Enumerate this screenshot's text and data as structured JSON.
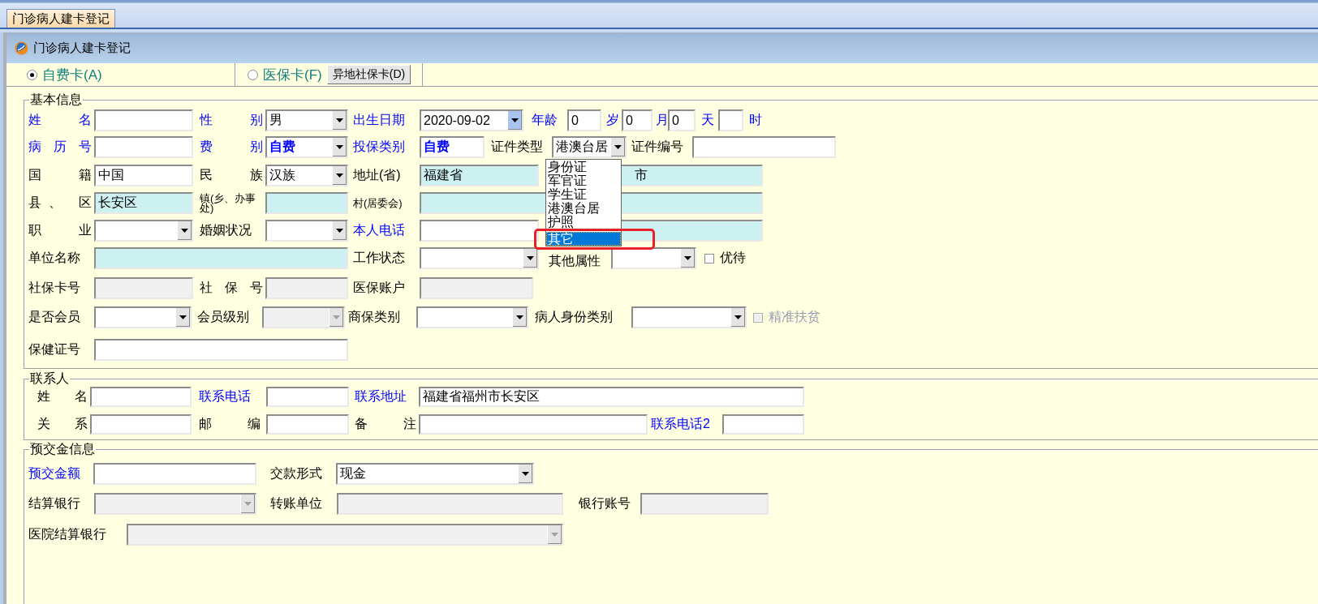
{
  "tab_bar": {
    "tabs": [
      {
        "label": "门诊病人建卡登记",
        "selected": true
      }
    ]
  },
  "window": {
    "title": "门诊病人建卡登记"
  },
  "card_types": [
    {
      "label": "自费卡(A)",
      "selected": true
    },
    {
      "label": "医保卡(F)",
      "selected": false
    }
  ],
  "remote_card_button": "异地社保卡(D)",
  "sections": [
    {
      "title": "基本信息",
      "lines": [
        {
          "items": [
            {
              "kind": "spaced_label",
              "text": "姓 名",
              "required": true
            },
            {
              "kind": "field"
            },
            {
              "kind": "spaced_label",
              "text": "性 别",
              "required": true
            },
            {
              "kind": "combo",
              "value": "男",
              "disabled": false
            },
            {
              "kind": "label",
              "text": "出生日期",
              "required": true
            },
            {
              "kind": "date",
              "value": "2020-09-02"
            },
            {
              "kind": "label",
              "text": "年龄",
              "required": true
            },
            {
              "kind": "field",
              "value": "0"
            },
            {
              "kind": "label",
              "text": "岁",
              "required": true
            },
            {
              "kind": "field",
              "value": "0"
            },
            {
              "kind": "label",
              "text": "月",
              "required": true
            },
            {
              "kind": "field",
              "value": "0"
            },
            {
              "kind": "label",
              "text": "天",
              "required": true
            },
            {
              "kind": "field"
            },
            {
              "kind": "label",
              "text": "时",
              "required": true
            }
          ]
        },
        {
          "items": [
            {
              "kind": "spaced_label",
              "text": "病 历 号",
              "required": true
            },
            {
              "kind": "field"
            },
            {
              "kind": "spaced_label",
              "text": "费 别",
              "required": true
            },
            {
              "kind": "combo",
              "value": "自费",
              "disabled": false,
              "bold": true
            },
            {
              "kind": "label",
              "text": "投保类别",
              "required": true
            },
            {
              "kind": "field",
              "value": "自费",
              "bold": true
            },
            {
              "kind": "label",
              "text": "证件类型",
              "required": false
            },
            {
              "kind": "combo",
              "value": "港澳台居",
              "disabled": false
            },
            {
              "kind": "label",
              "text": "证件编号",
              "required": false
            },
            {
              "kind": "field"
            }
          ]
        },
        {
          "items": [
            {
              "kind": "spaced_label",
              "text": "国 籍",
              "required": false
            },
            {
              "kind": "field",
              "value": "中国"
            },
            {
              "kind": "spaced_label",
              "text": "民 族",
              "required": false
            },
            {
              "kind": "combo",
              "value": "汉族",
              "disabled": false
            },
            {
              "kind": "label",
              "text": "地址(省)",
              "required": false
            },
            {
              "kind": "filled_field",
              "value": "福建省"
            },
            {
              "kind": "filled_field",
              "value": "市"
            }
          ]
        },
        {
          "items": [
            {
              "kind": "spaced_label",
              "text": "县、 区",
              "required": false
            },
            {
              "kind": "filled_field",
              "value": "长安区"
            },
            {
              "kind": "small_label",
              "text": "镇(乡、办事处)",
              "required": false
            },
            {
              "kind": "filled_field"
            },
            {
              "kind": "small_label",
              "text": "村(居委会)",
              "required": false
            },
            {
              "kind": "filled_field"
            }
          ]
        },
        {
          "items": [
            {
              "kind": "spaced_label",
              "text": "职 业",
              "required": false
            },
            {
              "kind": "combo",
              "disabled": false
            },
            {
              "kind": "label",
              "text": "婚姻状况",
              "required": false
            },
            {
              "kind": "combo",
              "disabled": false
            },
            {
              "kind": "label",
              "text": "本人电话",
              "required": true
            },
            {
              "kind": "field"
            },
            {
              "kind": "filled_field"
            }
          ]
        },
        {
          "items": [
            {
              "kind": "label",
              "text": "单位名称",
              "required": false
            },
            {
              "kind": "filled_field"
            },
            {
              "kind": "label",
              "text": "工作状态",
              "required": false
            },
            {
              "kind": "combo",
              "disabled": false
            },
            {
              "kind": "label",
              "text": "其他属性",
              "required": false
            },
            {
              "kind": "combo",
              "disabled": false
            },
            {
              "kind": "checkbox",
              "text": "优待",
              "checked": false,
              "disabled": false
            }
          ]
        },
        {
          "items": [
            {
              "kind": "label",
              "text": "社保卡号",
              "required": false
            },
            {
              "kind": "readonly_field"
            },
            {
              "kind": "spaced_label",
              "text": "社 保 号",
              "required": false
            },
            {
              "kind": "readonly_field"
            },
            {
              "kind": "label",
              "text": "医保账户",
              "required": false
            },
            {
              "kind": "readonly_field"
            }
          ]
        },
        {
          "items": [
            {
              "kind": "label",
              "text": "是否会员",
              "required": false
            },
            {
              "kind": "combo",
              "disabled": false
            },
            {
              "kind": "label",
              "text": "会员级别",
              "required": false
            },
            {
              "kind": "combo",
              "disabled": true
            },
            {
              "kind": "label",
              "text": "商保类别",
              "required": false
            },
            {
              "kind": "combo",
              "disabled": false
            },
            {
              "kind": "label",
              "text": "病人身份类别",
              "required": false
            },
            {
              "kind": "combo",
              "disabled": false
            },
            {
              "kind": "checkbox",
              "text": "精准扶贫",
              "checked": false,
              "disabled": true
            }
          ]
        },
        {
          "items": [
            {
              "kind": "label",
              "text": "保健证号",
              "required": false
            },
            {
              "kind": "field"
            }
          ]
        }
      ]
    },
    {
      "title": "联系人",
      "lines": [
        {
          "items": [
            {
              "kind": "spaced_label",
              "text": "姓 名",
              "required": false
            },
            {
              "kind": "field"
            },
            {
              "kind": "label",
              "text": "联系电话",
              "required": true
            },
            {
              "kind": "field"
            },
            {
              "kind": "label",
              "text": "联系地址",
              "required": true
            },
            {
              "kind": "field",
              "value": "福建省福州市长安区"
            }
          ]
        },
        {
          "items": [
            {
              "kind": "spaced_label",
              "text": "关 系",
              "required": false
            },
            {
              "kind": "field"
            },
            {
              "kind": "spaced_label",
              "text": "邮 编",
              "required": false
            },
            {
              "kind": "field"
            },
            {
              "kind": "spaced_label",
              "text": "备 注",
              "required": false
            },
            {
              "kind": "field"
            },
            {
              "kind": "label",
              "text": "联系电话2",
              "required": true
            },
            {
              "kind": "field"
            }
          ]
        }
      ]
    },
    {
      "title": "预交金信息",
      "lines": [
        {
          "items": [
            {
              "kind": "label",
              "text": "预交金额",
              "required": true
            },
            {
              "kind": "field"
            },
            {
              "kind": "label",
              "text": "交款形式",
              "required": false
            },
            {
              "kind": "combo",
              "value": "现金",
              "disabled": false
            }
          ]
        },
        {
          "items": [
            {
              "kind": "label",
              "text": "结算银行",
              "required": false
            },
            {
              "kind": "combo",
              "disabled": true
            },
            {
              "kind": "label",
              "text": "转账单位",
              "required": false
            },
            {
              "kind": "readonly_field"
            },
            {
              "kind": "label",
              "text": "银行账号",
              "required": false
            },
            {
              "kind": "readonly_field"
            }
          ]
        },
        {
          "items": [
            {
              "kind": "label",
              "text": "医院结算银行",
              "required": false
            },
            {
              "kind": "combo",
              "disabled": true
            }
          ]
        }
      ]
    }
  ],
  "id_type_dropdown": {
    "items": [
      {
        "label": "身份证",
        "selected": false
      },
      {
        "label": "军官证",
        "selected": false
      },
      {
        "label": "学生证",
        "selected": false
      },
      {
        "label": "港澳台居",
        "selected": false
      },
      {
        "label": "护照",
        "selected": false
      },
      {
        "label": "其它",
        "selected": true
      }
    ]
  },
  "annotation": {
    "kind": "frame",
    "color": "#e8202a"
  }
}
